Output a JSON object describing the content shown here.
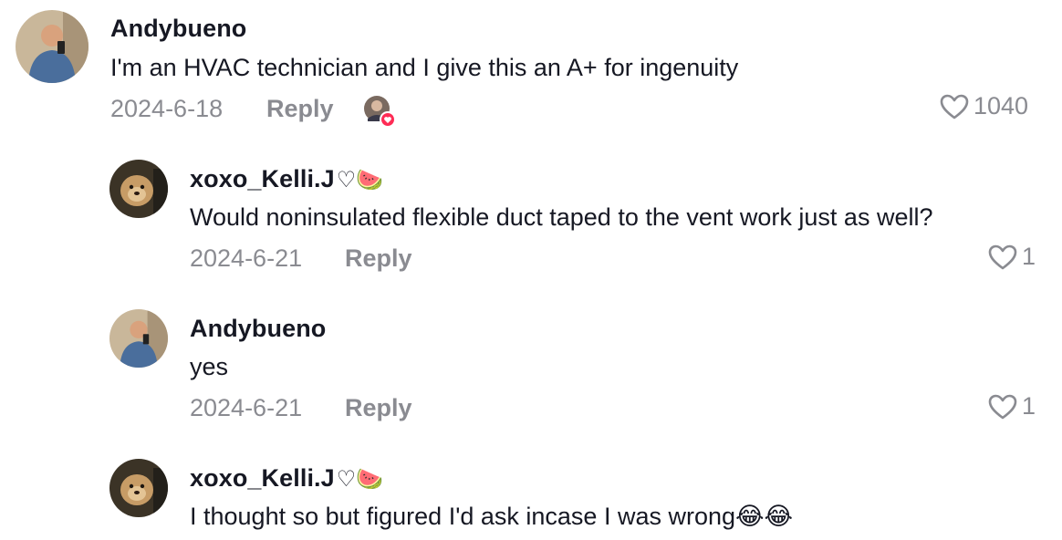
{
  "comments": [
    {
      "username": "Andybueno",
      "text": "I'm an HVAC technician and I give this an A+ for ingenuity",
      "date": "2024-6-18",
      "reply_label": "Reply",
      "likes": "1040"
    },
    {
      "username": "xoxo_Kelli.J",
      "username_suffix": "♡🍉",
      "text": "Would noninsulated flexible duct taped to the vent work just as well?",
      "date": "2024-6-21",
      "reply_label": "Reply",
      "likes": "1"
    },
    {
      "username": "Andybueno",
      "text": "yes",
      "date": "2024-6-21",
      "reply_label": "Reply",
      "likes": "1"
    },
    {
      "username": "xoxo_Kelli.J",
      "username_suffix": "♡🍉",
      "text": "I thought so but figured I'd ask incase I was wrong😂😂"
    }
  ],
  "icons": {
    "like": "heart-outline-icon",
    "creator_liked": "creator-liked-avatar-icon"
  },
  "colors": {
    "text_primary": "#161823",
    "text_secondary": "#8a8b91",
    "liked_badge": "#fe2c55"
  }
}
